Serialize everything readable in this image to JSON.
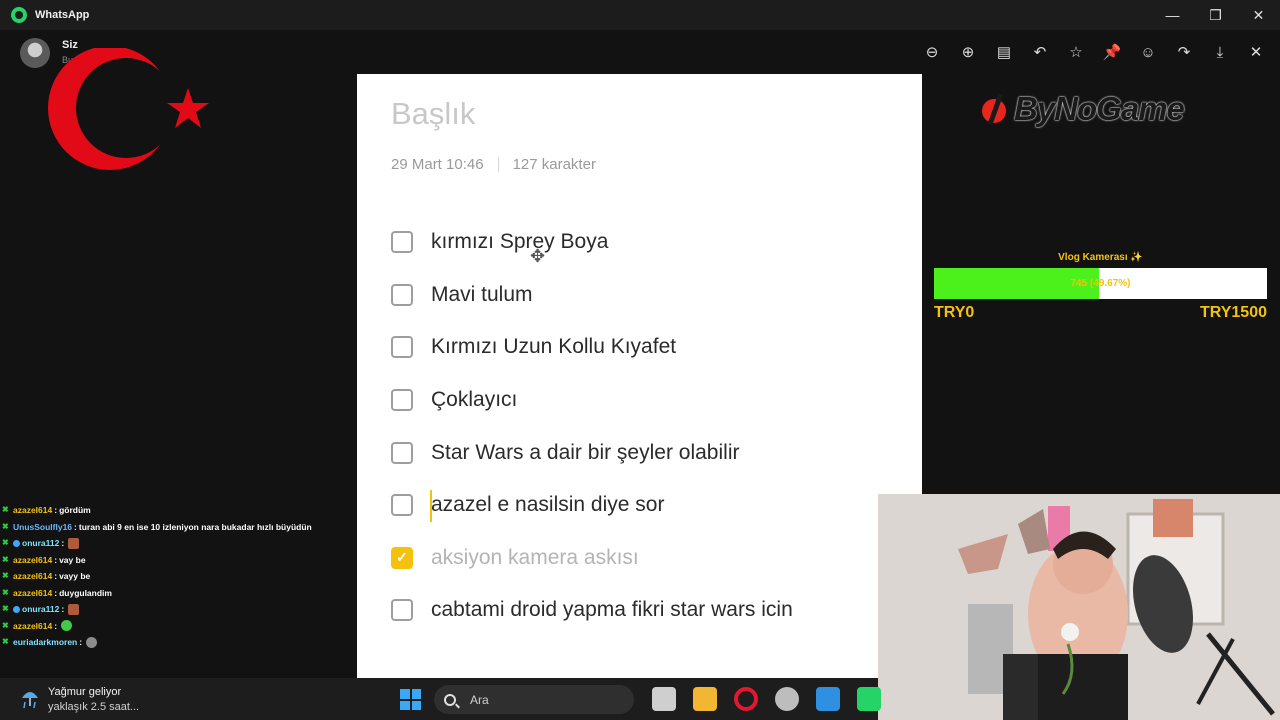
{
  "window": {
    "app_title": "WhatsApp",
    "minimize": "—",
    "restore": "❐",
    "close": "✕"
  },
  "viewer": {
    "sender": "Siz",
    "sender_sub": "Bu",
    "tools": [
      {
        "icon": "zoom-out-icon",
        "glyph": "⊖"
      },
      {
        "icon": "zoom-in-icon",
        "glyph": "⊕"
      },
      {
        "icon": "caption-icon",
        "glyph": "▤"
      },
      {
        "icon": "reply-icon",
        "glyph": "↶"
      },
      {
        "icon": "star-icon",
        "glyph": "☆"
      },
      {
        "icon": "pin-icon",
        "glyph": "📌"
      },
      {
        "icon": "emoji-icon",
        "glyph": "☺"
      },
      {
        "icon": "forward-icon",
        "glyph": "↷"
      },
      {
        "icon": "download-icon",
        "glyph": "⤓"
      },
      {
        "icon": "close-icon",
        "glyph": "✕"
      }
    ]
  },
  "note": {
    "title": "Başlık",
    "date": "29 Mart  10:46",
    "chars": "127 karakter",
    "items": [
      {
        "text": "kırmızı Sprey Boya",
        "checked": false
      },
      {
        "text": "Mavi tulum",
        "checked": false
      },
      {
        "text": "Kırmızı Uzun Kollu Kıyafet",
        "checked": false
      },
      {
        "text": "Çoklayıcı",
        "checked": false
      },
      {
        "text": "Star Wars a dair bir şeyler olabilir",
        "checked": false
      },
      {
        "text": "azazel e nasilsin diye sor",
        "checked": false
      },
      {
        "text": "aksiyon kamera askısı",
        "checked": true
      },
      {
        "text": "cabtami droid yapma fikri star wars icin",
        "checked": false
      }
    ]
  },
  "brand": {
    "text": "ByNoGame",
    "color": "#1a1a1a",
    "accent": "#e8261c"
  },
  "goal": {
    "title": "Vlog Kamerası ✨",
    "bar_text": "745 (49.67%)",
    "progress": 0.4967,
    "min_label": "TRY0",
    "max_label": "TRY1500",
    "fill_color": "#4cf01a",
    "text_color": "#f4c20d"
  },
  "chat": [
    {
      "user": "azazel614",
      "msg": "gördüm",
      "color": "yellow",
      "sub": false,
      "emote": ""
    },
    {
      "user": "UnusSoulfly16",
      "msg": "turan abi 9 en ise 10 izleniyon nara bukadar hızlı büyüdün",
      "color": "blue",
      "sub": false,
      "emote": ""
    },
    {
      "user": "onura112",
      "msg": "",
      "color": "cyan",
      "sub": true,
      "emote": "brown"
    },
    {
      "user": "azazel614",
      "msg": "vay be",
      "color": "yellow",
      "sub": false,
      "emote": ""
    },
    {
      "user": "azazel614",
      "msg": "vayy be",
      "color": "yellow",
      "sub": false,
      "emote": ""
    },
    {
      "user": "azazel614",
      "msg": "duygulandim",
      "color": "yellow",
      "sub": false,
      "emote": ""
    },
    {
      "user": "onura112",
      "msg": "",
      "color": "cyan",
      "sub": true,
      "emote": "brown"
    },
    {
      "user": "azazel614",
      "msg": "",
      "color": "yellow",
      "sub": false,
      "emote": "green"
    },
    {
      "user": "euriadarkmoren",
      "msg": "",
      "color": "cyan",
      "sub": false,
      "emote": "gray"
    }
  ],
  "taskbar": {
    "weather_title": "Yağmur geliyor",
    "weather_sub": "yaklaşık 2.5 saat...",
    "search_placeholder": "Ara",
    "apps": [
      {
        "name": "task-view-icon",
        "color": "#cfcfcf"
      },
      {
        "name": "file-explorer-icon",
        "color": "#f2b632"
      },
      {
        "name": "opera-icon",
        "color": "#e3172d"
      },
      {
        "name": "steam-icon",
        "color": "#bdbdbd"
      },
      {
        "name": "photos-icon",
        "color": "#2f8fe0"
      },
      {
        "name": "whatsapp-icon",
        "color": "#25d366"
      }
    ]
  }
}
